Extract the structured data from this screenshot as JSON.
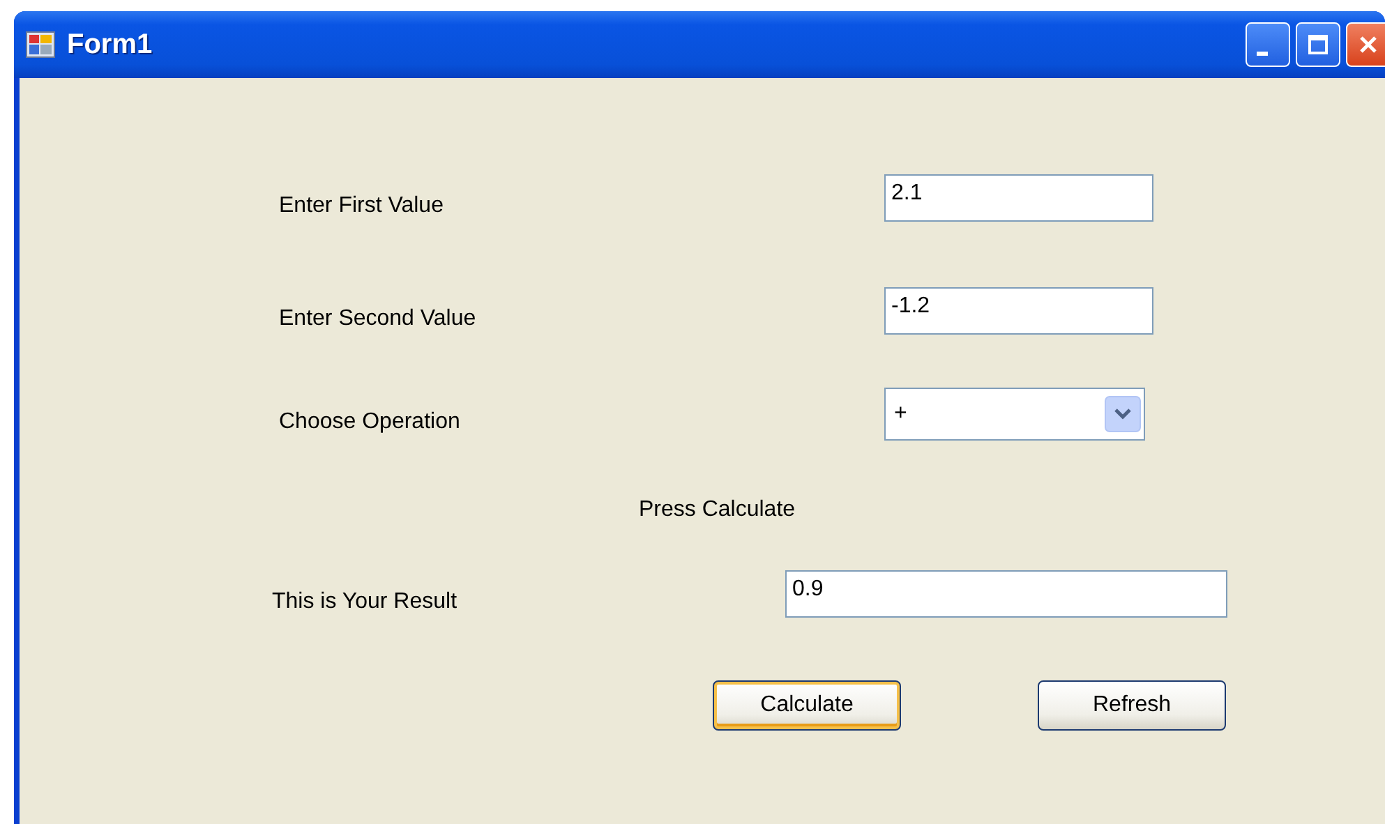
{
  "window": {
    "title": "Form1"
  },
  "fields": [
    {
      "label": "Enter First Value",
      "value": "2.1",
      "kind": "text"
    },
    {
      "label": "Enter Second Value",
      "value": "-1.2",
      "kind": "text"
    },
    {
      "label": "Choose Operation",
      "value": "+",
      "kind": "dropdown"
    }
  ],
  "prompt": "Press Calculate",
  "result": {
    "label": "This is Your Result",
    "value": "0.9"
  },
  "buttons": [
    {
      "label": "Calculate",
      "focused": true
    },
    {
      "label": "Refresh",
      "focused": false
    }
  ]
}
